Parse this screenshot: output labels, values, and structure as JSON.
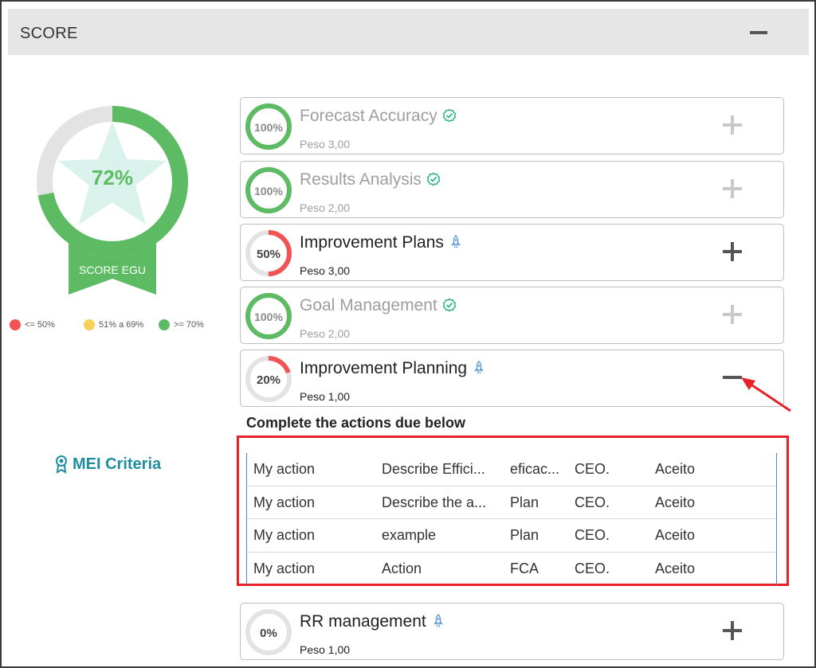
{
  "header": {
    "title": "SCORE"
  },
  "score": {
    "value": 0.72,
    "label": "72%",
    "ribbon_label": "SCORE EGU",
    "colors": {
      "good": "#5dbb63",
      "track": "#e3e3e3",
      "star": "#d9f3ec"
    }
  },
  "legend": [
    {
      "label": "<= 50%",
      "color": "#f05454"
    },
    {
      "label": "51% a 69%",
      "color": "#f7cf59"
    },
    {
      "label": ">= 70%",
      "color": "#5dbb63"
    }
  ],
  "mei_link": {
    "label": "MEI Criteria",
    "icon": "award-ribbon-icon"
  },
  "criteria": [
    {
      "title": "Forecast Accuracy",
      "weight": "Peso 3,00",
      "percent": 1.0,
      "percent_label": "100%",
      "status_icon": "check-circle-icon",
      "state": "done",
      "toggle": "plus"
    },
    {
      "title": "Results Analysis",
      "weight": "Peso 2,00",
      "percent": 1.0,
      "percent_label": "100%",
      "status_icon": "check-circle-icon",
      "state": "done",
      "toggle": "plus"
    },
    {
      "title": "Improvement Plans",
      "weight": "Peso 3,00",
      "percent": 0.5,
      "percent_label": "50%",
      "status_icon": "rocket-icon",
      "state": "open",
      "toggle": "plus"
    },
    {
      "title": "Goal Management",
      "weight": "Peso 2,00",
      "percent": 1.0,
      "percent_label": "100%",
      "status_icon": "check-circle-icon",
      "state": "done",
      "toggle": "plus"
    },
    {
      "title": "Improvement Planning",
      "weight": "Peso 1,00",
      "percent": 0.2,
      "percent_label": "20%",
      "status_icon": "rocket-icon",
      "state": "open",
      "toggle": "minus"
    },
    {
      "title": "RR management",
      "weight": "Peso 1,00",
      "percent": 0.0,
      "percent_label": "0%",
      "status_icon": "rocket-icon",
      "state": "open",
      "toggle": "plus"
    }
  ],
  "actions": {
    "title": "Complete the actions due below",
    "rows": [
      [
        "My action",
        "Describe Effici...",
        "eficac...",
        "CEO.",
        "Aceito"
      ],
      [
        "My action",
        "Describe the a...",
        "Plan",
        "CEO.",
        "Aceito"
      ],
      [
        "My action",
        "example",
        "Plan",
        "CEO.",
        "Aceito"
      ],
      [
        "My action",
        "Action",
        "FCA",
        "CEO.",
        "Aceito"
      ]
    ]
  },
  "colors": {
    "done_ring": "#5dbb63",
    "partial_ring": "#f05454",
    "ring_track": "#e3e3e3",
    "check": "#2fb58a",
    "rocket": "#5b9bd5",
    "highlight": "#e8202a"
  }
}
